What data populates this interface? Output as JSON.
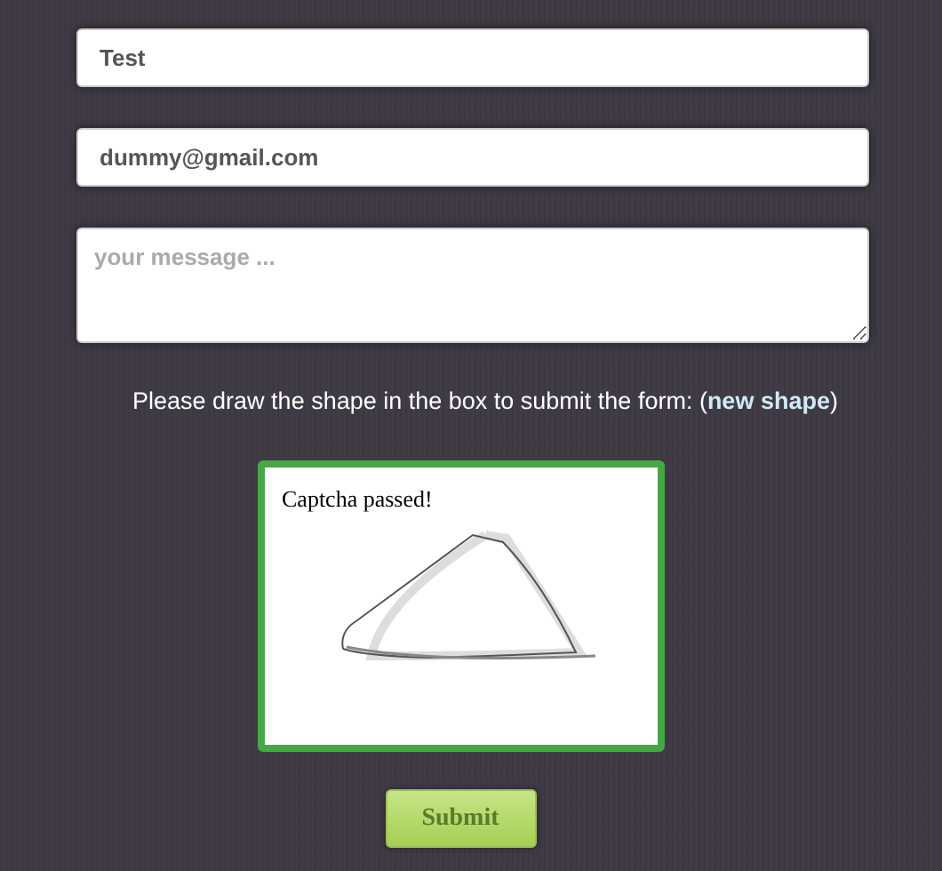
{
  "form": {
    "name": {
      "value": "Test"
    },
    "email": {
      "value": "dummy@gmail.com"
    },
    "message": {
      "placeholder": "your message ..."
    }
  },
  "instruction": {
    "text": "Please draw the shape in the box to submit the form: (",
    "link": "new shape",
    "text_end": ")"
  },
  "captcha": {
    "message": "Captcha passed!",
    "passed": true
  },
  "buttons": [
    {
      "label": "Submit"
    }
  ]
}
